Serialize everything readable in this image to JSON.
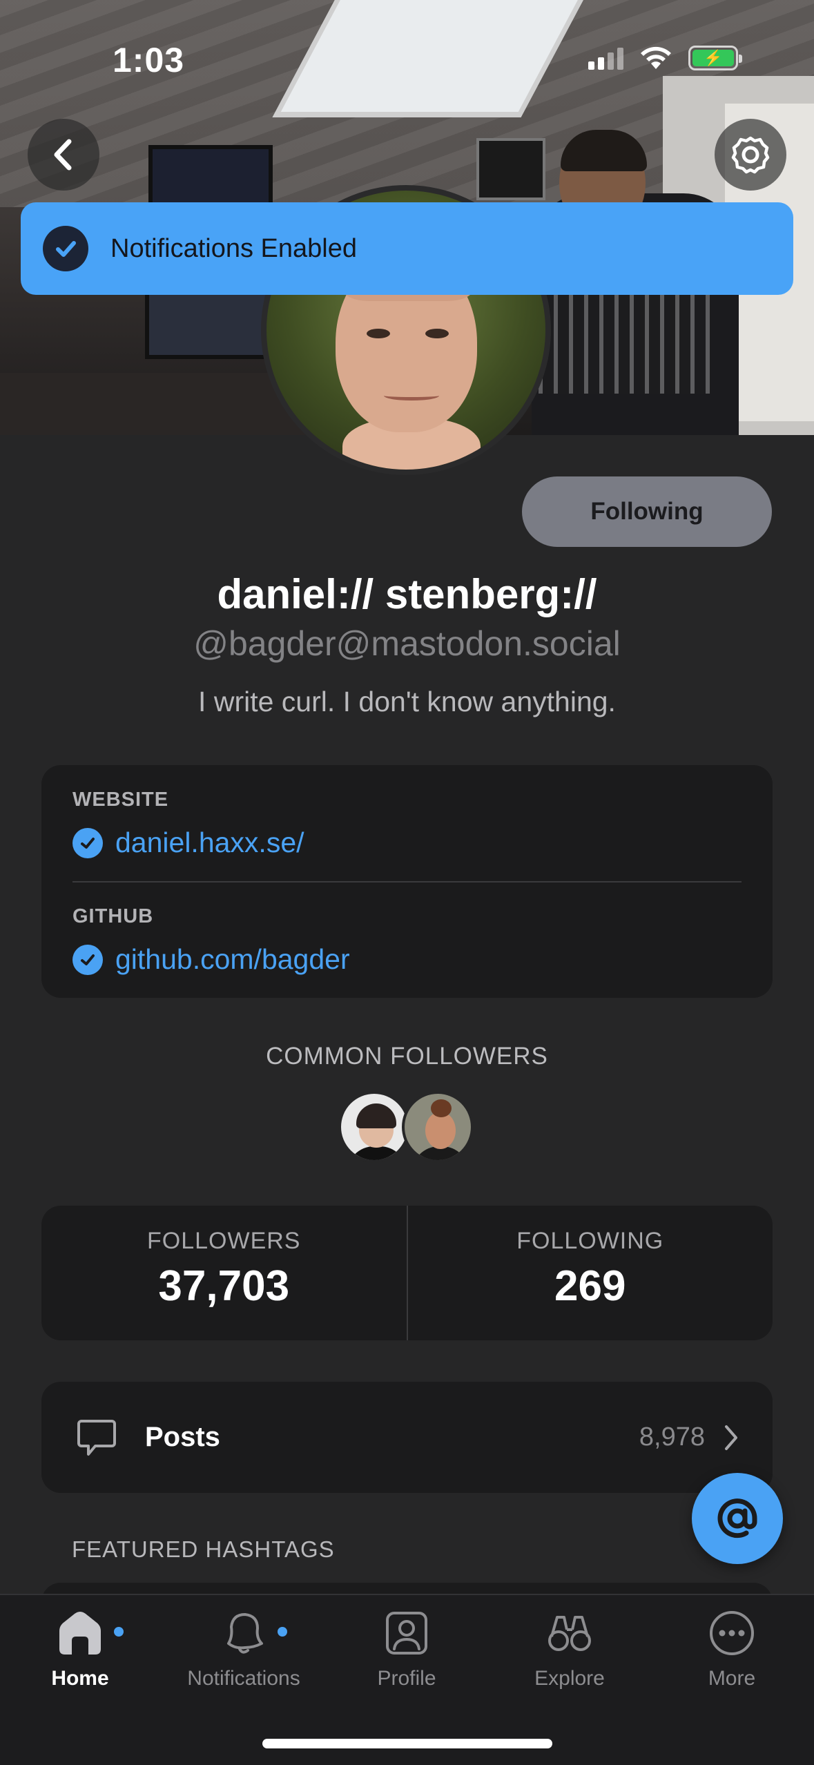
{
  "status_bar": {
    "time": "1:03"
  },
  "header": {
    "back_icon": "chevron-left-icon",
    "settings_icon": "gear-icon"
  },
  "toast": {
    "text": "Notifications Enabled",
    "icon": "checkmark-icon",
    "color": "#49a3f7"
  },
  "profile": {
    "follow_button": "Following",
    "display_name": "daniel:// stenberg://",
    "handle": "@bagder@mastodon.social",
    "bio": "I write curl. I don't know anything."
  },
  "fields": [
    {
      "label": "WEBSITE",
      "value": "daniel.haxx.se/",
      "verified": true
    },
    {
      "label": "GITHUB",
      "value": "github.com/bagder",
      "verified": true
    }
  ],
  "common_followers": {
    "label": "COMMON FOLLOWERS"
  },
  "stats": {
    "followers_label": "FOLLOWERS",
    "followers_value": "37,703",
    "following_label": "FOLLOWING",
    "following_value": "269"
  },
  "posts": {
    "label": "Posts",
    "count": "8,978"
  },
  "featured": {
    "label": "FEATURED HASHTAGS"
  },
  "tabs": [
    {
      "label": "Home",
      "icon": "home-icon",
      "active": true,
      "dot": true
    },
    {
      "label": "Notifications",
      "icon": "bell-icon",
      "active": false,
      "dot": true
    },
    {
      "label": "Profile",
      "icon": "profile-icon",
      "active": false,
      "dot": false
    },
    {
      "label": "Explore",
      "icon": "binoculars-icon",
      "active": false,
      "dot": false
    },
    {
      "label": "More",
      "icon": "more-icon",
      "active": false,
      "dot": false
    }
  ],
  "colors": {
    "accent": "#4aa2f4",
    "background": "#262627",
    "card": "#1b1b1c"
  }
}
